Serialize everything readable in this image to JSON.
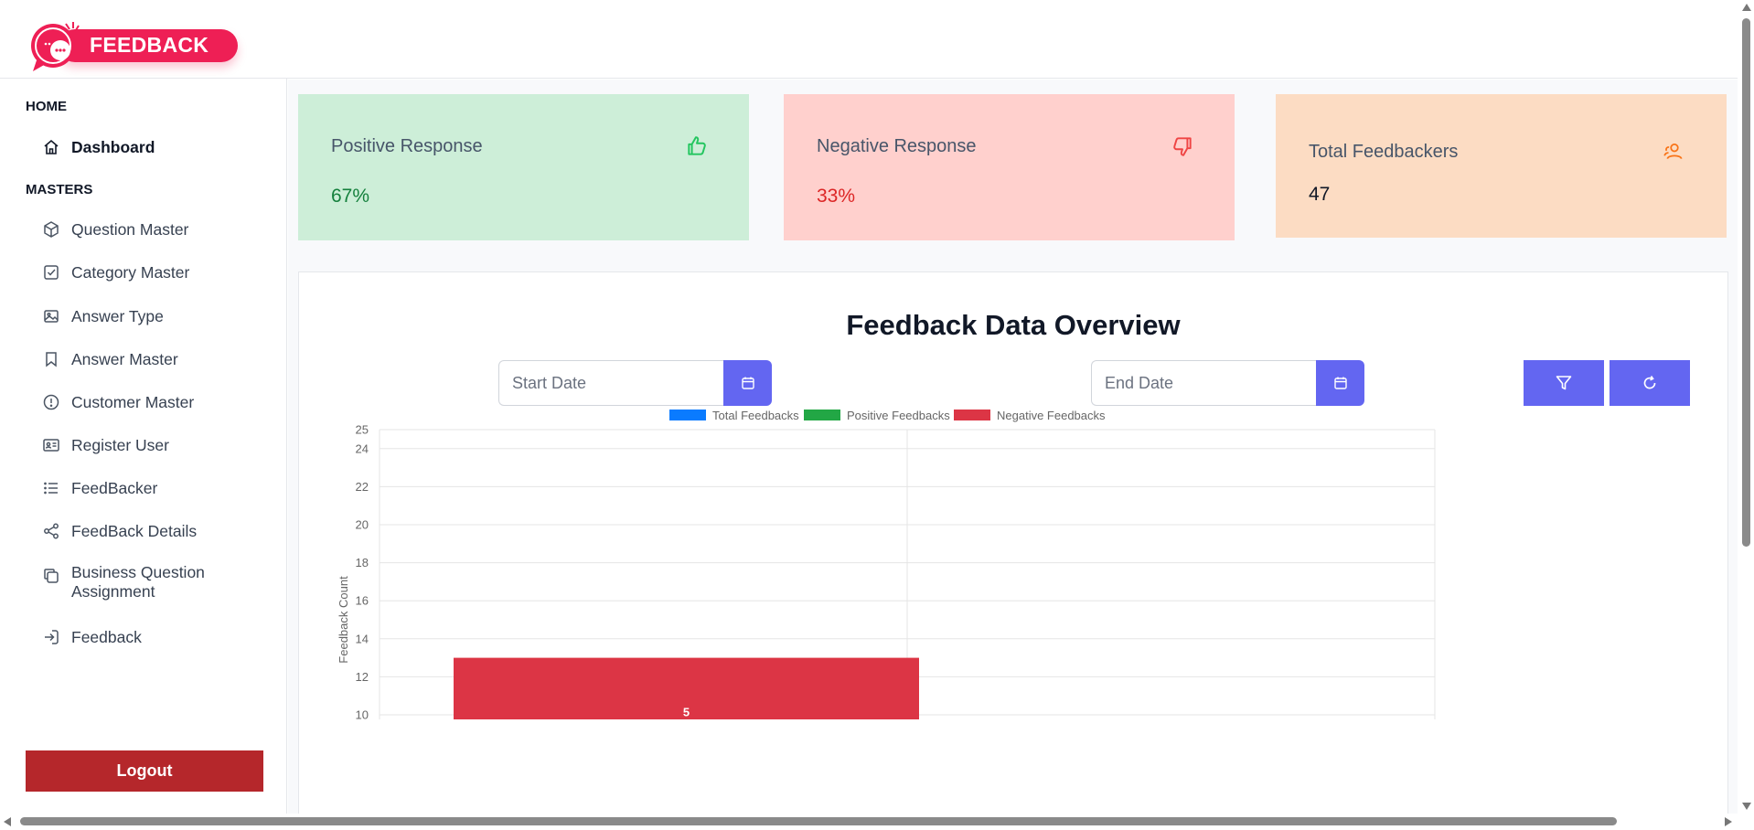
{
  "brand": {
    "logo_text": "FEEDBACK"
  },
  "sidebar": {
    "sections": [
      {
        "title": "HOME"
      },
      {
        "title": "MASTERS"
      }
    ],
    "items": [
      {
        "label": "Dashboard",
        "icon": "home-icon",
        "active": true
      },
      {
        "label": "Question Master",
        "icon": "cube-icon"
      },
      {
        "label": "Category Master",
        "icon": "checkbox-icon"
      },
      {
        "label": "Answer Type",
        "icon": "image-icon"
      },
      {
        "label": "Answer Master",
        "icon": "bookmark-icon"
      },
      {
        "label": "Customer Master",
        "icon": "alert-circle-icon"
      },
      {
        "label": "Register User",
        "icon": "id-card-icon"
      },
      {
        "label": "FeedBacker",
        "icon": "list-icon"
      },
      {
        "label": "FeedBack Details",
        "icon": "share-icon"
      },
      {
        "label": "Business Question Assignment",
        "icon": "copy-icon"
      },
      {
        "label": "Feedback",
        "icon": "login-icon"
      }
    ],
    "logout_label": "Logout"
  },
  "cards": [
    {
      "label": "Positive Response",
      "value": "67%",
      "icon": "thumbs-up-icon",
      "bg": "#cdeed8",
      "value_color": "#15803d",
      "icon_color": "#22c55e"
    },
    {
      "label": "Negative Response",
      "value": "33%",
      "icon": "thumbs-down-icon",
      "bg": "#ffd0cd",
      "value_color": "#dc2626",
      "icon_color": "#ef4444"
    },
    {
      "label": "Total Feedbackers",
      "value": "47",
      "icon": "users-icon",
      "bg": "#fcdcc3",
      "value_color": "#111827",
      "icon_color": "#f97316"
    }
  ],
  "panel": {
    "title": "Feedback Data Overview",
    "start_placeholder": "Start Date",
    "end_placeholder": "End Date",
    "accent": "#6366f1"
  },
  "chart_data": {
    "type": "bar",
    "title": "",
    "ylabel": "Feedback Count",
    "xlabel": "",
    "ylim": [
      10,
      25
    ],
    "y_ticks": [
      10,
      12,
      14,
      16,
      18,
      20,
      22,
      24,
      25
    ],
    "legend": "top",
    "series": [
      {
        "name": "Total Feedbacks",
        "color": "#0a7bff"
      },
      {
        "name": "Positive Feedbacks",
        "color": "#22a745"
      },
      {
        "name": "Negative Feedbacks",
        "color": "#dc3545"
      }
    ],
    "bars": [
      {
        "series": "Negative Feedbacks",
        "value": 13,
        "label": "5"
      }
    ]
  }
}
